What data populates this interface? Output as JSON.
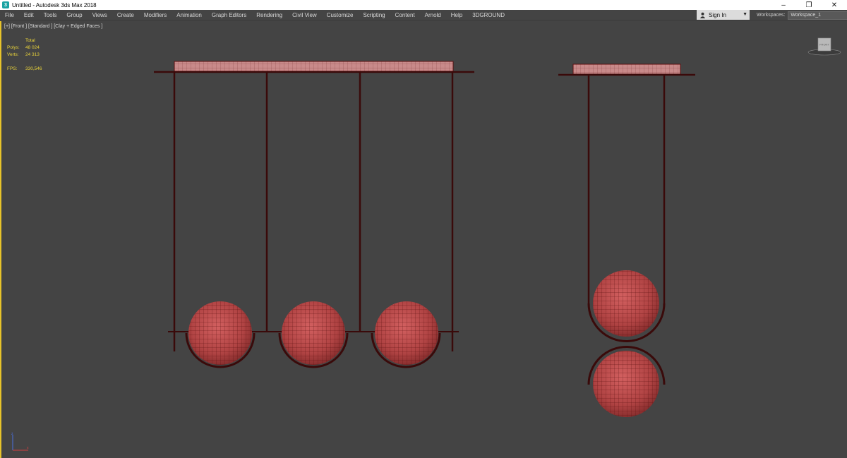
{
  "window": {
    "title": "Untitled - Autodesk 3ds Max 2018",
    "controls": [
      "–",
      "❐",
      "✕"
    ]
  },
  "menu": [
    "File",
    "Edit",
    "Tools",
    "Group",
    "Views",
    "Create",
    "Modifiers",
    "Animation",
    "Graph Editors",
    "Rendering",
    "Civil View",
    "Customize",
    "Scripting",
    "Content",
    "Arnold",
    "Help",
    "3DGROUND"
  ],
  "account": {
    "signin_label": "Sign In"
  },
  "workspaces": {
    "label": "Workspaces:",
    "value": "Workspace_1"
  },
  "viewport": {
    "label": "[+] [Front ] [Standard ] [Clay + Edged Faces ]",
    "stats": {
      "header": "Total",
      "polys_label": "Polys:",
      "polys_value": "48 024",
      "verts_label": "Verts:",
      "verts_value": "24 313",
      "fps_label": "FPS:",
      "fps_value": "330,546"
    },
    "viewcube_label": "FRONT"
  },
  "colors": {
    "menu_text": "#d8d8d8",
    "viewport_bg": "#444444",
    "active_border": "#e8c32a",
    "stats_text": "#e8d23a",
    "model_fill": "#b94848",
    "wire": "#5a1010",
    "frame": "#3a0a0a"
  }
}
